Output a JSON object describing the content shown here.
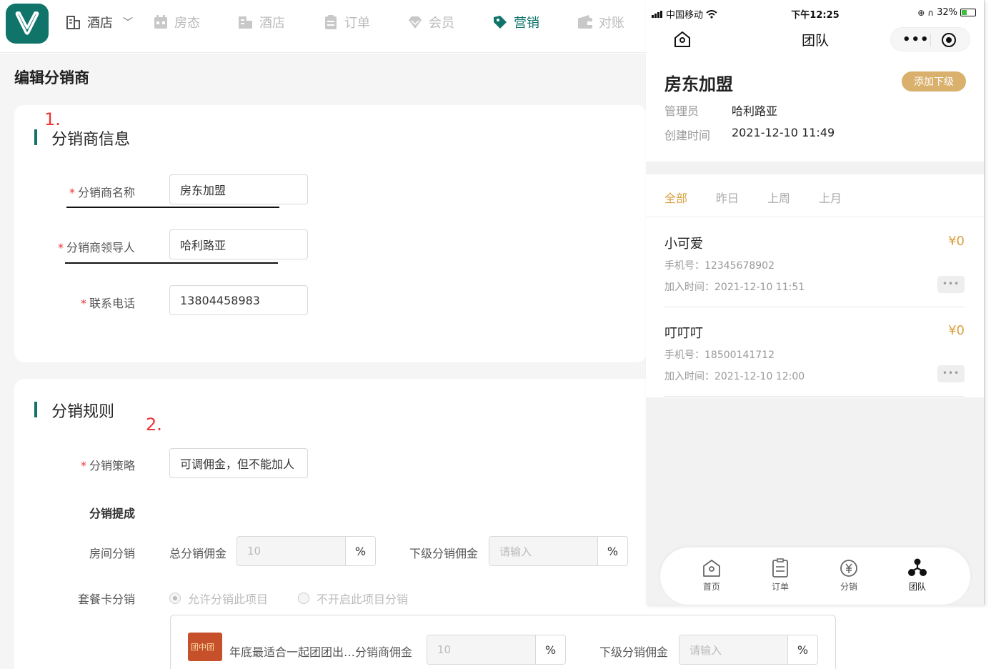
{
  "nav": {
    "hotel_selector": "酒店",
    "items": [
      {
        "label": "房态"
      },
      {
        "label": "酒店"
      },
      {
        "label": "订单"
      },
      {
        "label": "会员"
      },
      {
        "label": "营销"
      },
      {
        "label": "对账"
      }
    ]
  },
  "page": {
    "title": "编辑分销商"
  },
  "section1": {
    "annotation": "1.",
    "title": "分销商信息",
    "fields": [
      {
        "label": "分销商名称",
        "value": "房东加盟"
      },
      {
        "label": "分销商领导人",
        "value": "哈利路亚"
      },
      {
        "label": "联系电话",
        "value": "13804458983"
      }
    ]
  },
  "section2": {
    "annotation": "2.",
    "title": "分销规则",
    "strategy_label": "分销策略",
    "strategy_value": "可调佣金，但不能加人",
    "commission_heading": "分销提成",
    "room_label": "房间分销",
    "total_label": "总分销佣金",
    "total_value": "10",
    "sub_label": "下级分销佣金",
    "sub_placeholder": "请输入",
    "percent": "%",
    "package_label": "套餐卡分销",
    "radio_allow": "允许分销此项目",
    "radio_disallow": "不开启此项目分销",
    "package_name": "年底最适合一起团团出…",
    "package_commission_label": "分销商佣金",
    "package_commission_value": "10",
    "package_sub_label": "下级分销佣金",
    "package_sub_placeholder": "请输入",
    "thumb_text": "团中团"
  },
  "phone": {
    "status": {
      "carrier": "中国移动",
      "time": "下午12:25",
      "battery": "32%"
    },
    "header_title": "团队",
    "capsule_more": "•••",
    "team": {
      "name": "房东加盟",
      "add_button": "添加下级",
      "admin_key": "管理员",
      "admin_value": "哈利路亚",
      "created_key": "创建时间",
      "created_value": "2021-12-10 11:49"
    },
    "tabs": [
      "全部",
      "昨日",
      "上周",
      "上月"
    ],
    "members": [
      {
        "name": "小可爱",
        "amount": "¥0",
        "phone": "手机号：12345678902",
        "joined": "加入时间：2021-12-10 11:51"
      },
      {
        "name": "叮叮叮",
        "amount": "¥0",
        "phone": "手机号：18500141712",
        "joined": "加入时间：2021-12-10 12:00"
      }
    ],
    "member_more": "•••",
    "tabbar": [
      "首页",
      "订单",
      "分销",
      "团队"
    ]
  },
  "colors": {
    "brand": "#10746a",
    "gold": "#d9a040",
    "add_button": "#d9b06c",
    "required": "#ee3333"
  }
}
